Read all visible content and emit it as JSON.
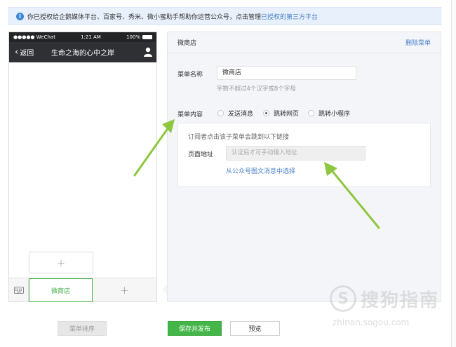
{
  "notice": {
    "icon": "info-icon",
    "text": "你已授权给企鹅媒体平台、百家号、秀米、微小蜜助手帮助你运营公众号，点击管理",
    "link": "已授权的第三方平台"
  },
  "phone": {
    "carrier": "●●●●● WeChat",
    "time": "1:21 AM",
    "battery": "100%",
    "back_label": "返回",
    "account_title": "生命之海的心中之岸",
    "menu_tab": "微商店",
    "add_symbol": "+"
  },
  "editor": {
    "header_title": "微商店",
    "delete_label": "删除菜单",
    "name_label": "菜单名称",
    "name_value": "微商店",
    "name_hint": "字数不超过4个汉字或8个字母",
    "content_label": "菜单内容",
    "options": [
      {
        "label": "发送消息",
        "selected": false
      },
      {
        "label": "跳转网页",
        "selected": true
      },
      {
        "label": "跳转小程序",
        "selected": false
      }
    ],
    "link_desc": "订阅者点击该子菜单会跳到以下链接",
    "url_label": "页面地址",
    "url_placeholder": "认证后才可手动输入地址",
    "choose_link": "从公众号图文消息中选择"
  },
  "buttons": {
    "sort": "菜单排序",
    "save": "保存并发布",
    "preview": "预览"
  },
  "watermark": {
    "logo": "S",
    "text": "搜狗指南",
    "url": "zhinan.sogou.com"
  },
  "colors": {
    "accent_green": "#44b549",
    "link_blue": "#4a7fc9",
    "arrow_green": "#8dc63f",
    "nav_dark": "#2f3033"
  }
}
